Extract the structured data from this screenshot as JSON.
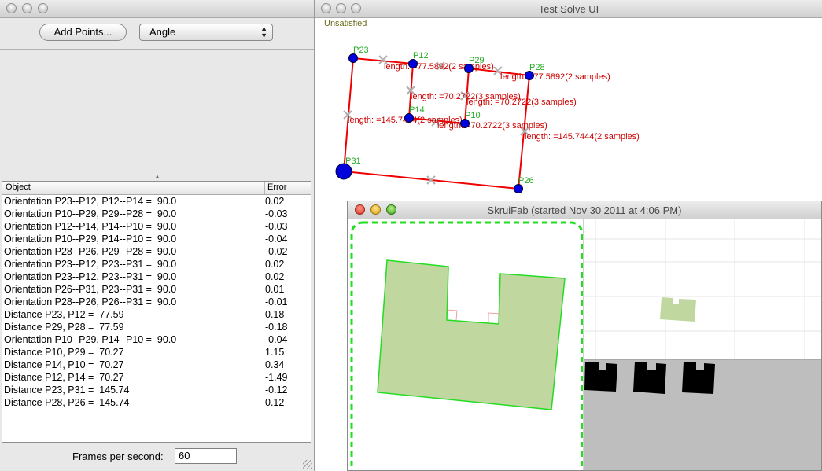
{
  "left_window": {
    "add_points_label": "Add Points...",
    "mode_select": {
      "value": "Angle"
    },
    "table": {
      "headers": {
        "object": "Object",
        "error": "Error"
      },
      "rows": [
        {
          "object": "Orientation P23--P12, P12--P14 =  90.0",
          "error": "0.02"
        },
        {
          "object": "Orientation P10--P29, P29--P28 =  90.0",
          "error": "-0.03"
        },
        {
          "object": "Orientation P12--P14, P14--P10 =  90.0",
          "error": "-0.03"
        },
        {
          "object": "Orientation P10--P29, P14--P10 =  90.0",
          "error": "-0.04"
        },
        {
          "object": "Orientation P28--P26, P29--P28 =  90.0",
          "error": "-0.02"
        },
        {
          "object": "Orientation P23--P12, P23--P31 =  90.0",
          "error": "0.02"
        },
        {
          "object": "Orientation P23--P12, P23--P31 =  90.0",
          "error": "0.02"
        },
        {
          "object": "Orientation P26--P31, P23--P31 =  90.0",
          "error": "0.01"
        },
        {
          "object": "Orientation P28--P26, P26--P31 =  90.0",
          "error": "-0.01"
        },
        {
          "object": "Distance P23, P12 =  77.59",
          "error": "0.18"
        },
        {
          "object": "Distance P29, P28 =  77.59",
          "error": "-0.18"
        },
        {
          "object": "Orientation P10--P29, P14--P10 =  90.0",
          "error": "-0.04"
        },
        {
          "object": "Distance P10, P29 =  70.27",
          "error": "1.15"
        },
        {
          "object": "Distance P14, P10 =  70.27",
          "error": "0.34"
        },
        {
          "object": "Distance P12, P14 =  70.27",
          "error": "-1.49"
        },
        {
          "object": "Distance P23, P31 =  145.74",
          "error": "-0.12"
        },
        {
          "object": "Distance P28, P26 =  145.74",
          "error": "0.12"
        }
      ]
    },
    "fps_label": "Frames per second:",
    "fps_value": "60"
  },
  "right_window": {
    "title": "Test Solve UI",
    "status": "Unsatisfied",
    "points": [
      {
        "name": "P23"
      },
      {
        "name": "P12"
      },
      {
        "name": "P29"
      },
      {
        "name": "P28"
      },
      {
        "name": "P14"
      },
      {
        "name": "P10"
      },
      {
        "name": "P31"
      },
      {
        "name": "P26"
      }
    ],
    "length_labels": [
      "length: =77.5892(2 samples)",
      "length: =77.5892(2 samples)",
      "length: =70.2722(3 samples)",
      "length: =70.2722(3 samples)",
      "length: =145.7444(2 samples)",
      "length: =70.2722(3 samples)",
      "length: =145.7444(2 samples)"
    ],
    "colors": {
      "segment": "#ee0000",
      "point": "#0000dd",
      "point_label": "#22aa22",
      "length_label": "#cc0000",
      "marker": "#b0b0b0"
    }
  },
  "skruifab_window": {
    "title": "SkruiFab (started Nov 30 2011 at 4:06 PM)",
    "colors": {
      "shape_fill": "#c0d8a0",
      "shape_stroke": "#22dd22",
      "bed_border": "#22dd22",
      "parts": "#000000",
      "tray": "#bebebe"
    }
  }
}
